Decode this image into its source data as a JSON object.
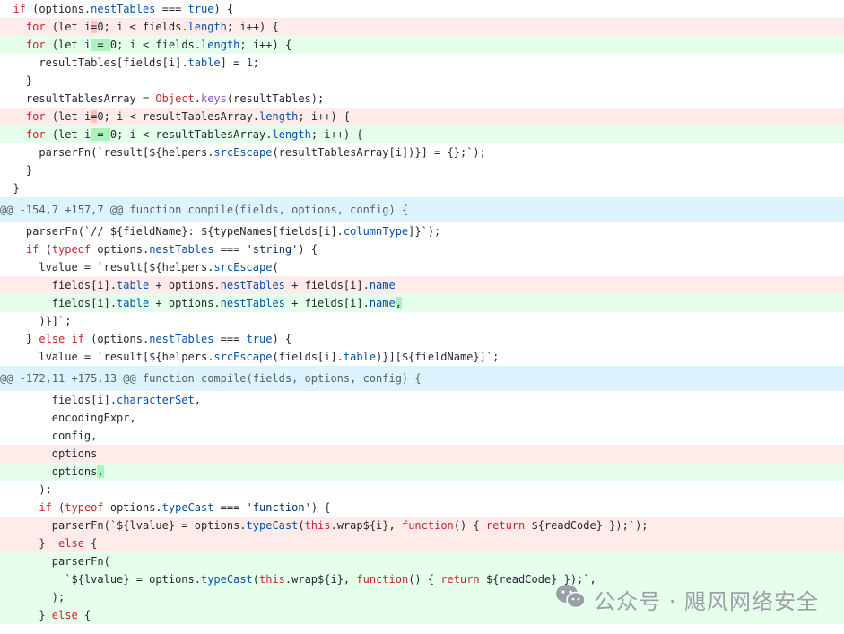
{
  "diff": {
    "lines": [
      {
        "type": "ctx",
        "tokens": [
          {
            "t": "  "
          },
          {
            "t": "if",
            "c": "kw"
          },
          {
            "t": " (options."
          },
          {
            "t": "nestTables",
            "c": "prop"
          },
          {
            "t": " === "
          },
          {
            "t": "true",
            "c": "prop"
          },
          {
            "t": ") {"
          }
        ]
      },
      {
        "type": "del",
        "tokens": [
          {
            "t": "    "
          },
          {
            "t": "for",
            "c": "kw"
          },
          {
            "t": " (let i"
          },
          {
            "t": "=",
            "c": "hl-del"
          },
          {
            "t": "0; i < fields."
          },
          {
            "t": "length",
            "c": "prop"
          },
          {
            "t": "; i++) {"
          }
        ]
      },
      {
        "type": "add",
        "tokens": [
          {
            "t": "    "
          },
          {
            "t": "for",
            "c": "kw"
          },
          {
            "t": " (let i"
          },
          {
            "t": " = ",
            "c": "hl-add"
          },
          {
            "t": "0; i < fields."
          },
          {
            "t": "length",
            "c": "prop"
          },
          {
            "t": "; i++) {"
          }
        ]
      },
      {
        "type": "ctx",
        "tokens": [
          {
            "t": "      resultTables[fields[i]."
          },
          {
            "t": "table",
            "c": "prop"
          },
          {
            "t": "] = "
          },
          {
            "t": "1",
            "c": "prop"
          },
          {
            "t": ";"
          }
        ]
      },
      {
        "type": "ctx",
        "tokens": [
          {
            "t": "    }"
          }
        ]
      },
      {
        "type": "ctx",
        "tokens": [
          {
            "t": "    resultTablesArray = "
          },
          {
            "t": "Object",
            "c": "kw"
          },
          {
            "t": "."
          },
          {
            "t": "keys",
            "c": "fn"
          },
          {
            "t": "(resultTables);"
          }
        ]
      },
      {
        "type": "del",
        "tokens": [
          {
            "t": "    "
          },
          {
            "t": "for",
            "c": "kw"
          },
          {
            "t": " (let i"
          },
          {
            "t": "=",
            "c": "hl-del"
          },
          {
            "t": "0; i < resultTablesArray."
          },
          {
            "t": "length",
            "c": "prop"
          },
          {
            "t": "; i++) {"
          }
        ]
      },
      {
        "type": "add",
        "tokens": [
          {
            "t": "    "
          },
          {
            "t": "for",
            "c": "kw"
          },
          {
            "t": " (let i"
          },
          {
            "t": " = ",
            "c": "hl-add"
          },
          {
            "t": "0; i < resultTablesArray."
          },
          {
            "t": "length",
            "c": "prop"
          },
          {
            "t": "; i++) {"
          }
        ]
      },
      {
        "type": "ctx",
        "tokens": [
          {
            "t": "      parserFn(`result[${helpers."
          },
          {
            "t": "srcEscape",
            "c": "prop"
          },
          {
            "t": "(resultTablesArray[i])}] = {};`);"
          }
        ]
      },
      {
        "type": "ctx",
        "tokens": [
          {
            "t": "    }"
          }
        ]
      },
      {
        "type": "ctx",
        "tokens": [
          {
            "t": "  }"
          }
        ]
      },
      {
        "type": "hunk",
        "tokens": [
          {
            "t": "@@ -154,7 +157,7 @@ function compile(fields, options, config) {"
          }
        ]
      },
      {
        "type": "ctx",
        "tokens": [
          {
            "t": "    parserFn(`// ${fieldName}: ${typeNames[fields[i]."
          },
          {
            "t": "columnType",
            "c": "prop"
          },
          {
            "t": "]}`);"
          }
        ]
      },
      {
        "type": "ctx",
        "tokens": [
          {
            "t": "    "
          },
          {
            "t": "if",
            "c": "kw"
          },
          {
            "t": " ("
          },
          {
            "t": "typeof",
            "c": "kw"
          },
          {
            "t": " options."
          },
          {
            "t": "nestTables",
            "c": "prop"
          },
          {
            "t": " === "
          },
          {
            "t": "'string'",
            "c": "str"
          },
          {
            "t": ") {"
          }
        ]
      },
      {
        "type": "ctx",
        "tokens": [
          {
            "t": "      lvalue = `result[${helpers."
          },
          {
            "t": "srcEscape",
            "c": "prop"
          },
          {
            "t": "("
          }
        ]
      },
      {
        "type": "del",
        "tokens": [
          {
            "t": "        fields[i]."
          },
          {
            "t": "table",
            "c": "prop"
          },
          {
            "t": " + options."
          },
          {
            "t": "nestTables",
            "c": "prop"
          },
          {
            "t": " + fields[i]."
          },
          {
            "t": "name",
            "c": "prop"
          }
        ]
      },
      {
        "type": "add",
        "tokens": [
          {
            "t": "        fields[i]."
          },
          {
            "t": "table",
            "c": "prop"
          },
          {
            "t": " + options."
          },
          {
            "t": "nestTables",
            "c": "prop"
          },
          {
            "t": " + fields[i]."
          },
          {
            "t": "name",
            "c": "prop"
          },
          {
            "t": ",",
            "c": "hl-add"
          }
        ]
      },
      {
        "type": "ctx",
        "tokens": [
          {
            "t": "      )}]`;"
          }
        ]
      },
      {
        "type": "ctx",
        "tokens": [
          {
            "t": "    } "
          },
          {
            "t": "else",
            "c": "kw"
          },
          {
            "t": " "
          },
          {
            "t": "if",
            "c": "kw"
          },
          {
            "t": " (options."
          },
          {
            "t": "nestTables",
            "c": "prop"
          },
          {
            "t": " === "
          },
          {
            "t": "true",
            "c": "prop"
          },
          {
            "t": ") {"
          }
        ]
      },
      {
        "type": "ctx",
        "tokens": [
          {
            "t": "      lvalue = `result[${helpers."
          },
          {
            "t": "srcEscape",
            "c": "prop"
          },
          {
            "t": "(fields[i]."
          },
          {
            "t": "table",
            "c": "prop"
          },
          {
            "t": ")}][${fieldName}]`;"
          }
        ]
      },
      {
        "type": "hunk",
        "tokens": [
          {
            "t": "@@ -172,11 +175,13 @@ function compile(fields, options, config) {"
          }
        ]
      },
      {
        "type": "ctx",
        "tokens": [
          {
            "t": "        fields[i]."
          },
          {
            "t": "characterSet",
            "c": "prop"
          },
          {
            "t": ","
          }
        ]
      },
      {
        "type": "ctx",
        "tokens": [
          {
            "t": "        encodingExpr,"
          }
        ]
      },
      {
        "type": "ctx",
        "tokens": [
          {
            "t": "        config,"
          }
        ]
      },
      {
        "type": "del",
        "tokens": [
          {
            "t": "        options"
          }
        ]
      },
      {
        "type": "add",
        "tokens": [
          {
            "t": "        options"
          },
          {
            "t": ",",
            "c": "hl-add"
          }
        ]
      },
      {
        "type": "ctx",
        "tokens": [
          {
            "t": "      );"
          }
        ]
      },
      {
        "type": "ctx",
        "tokens": [
          {
            "t": "      "
          },
          {
            "t": "if",
            "c": "kw"
          },
          {
            "t": " ("
          },
          {
            "t": "typeof",
            "c": "kw"
          },
          {
            "t": " options."
          },
          {
            "t": "typeCast",
            "c": "prop"
          },
          {
            "t": " === "
          },
          {
            "t": "'function'",
            "c": "str"
          },
          {
            "t": ") {"
          }
        ]
      },
      {
        "type": "del",
        "tokens": [
          {
            "t": "        parserFn(`${lvalue} = options."
          },
          {
            "t": "typeCast",
            "c": "prop"
          },
          {
            "t": "("
          },
          {
            "t": "this",
            "c": "kw"
          },
          {
            "t": ".wrap${i}, "
          },
          {
            "t": "function",
            "c": "kw"
          },
          {
            "t": "() { "
          },
          {
            "t": "return",
            "c": "kw"
          },
          {
            "t": " ${readCode} });`);"
          }
        ]
      },
      {
        "type": "del",
        "tokens": [
          {
            "t": "      }  "
          },
          {
            "t": "else",
            "c": "kw"
          },
          {
            "t": " {"
          }
        ]
      },
      {
        "type": "add",
        "tokens": [
          {
            "t": "        parserFn("
          }
        ]
      },
      {
        "type": "add",
        "tokens": [
          {
            "t": "          `${lvalue} = options."
          },
          {
            "t": "typeCast",
            "c": "prop"
          },
          {
            "t": "("
          },
          {
            "t": "this",
            "c": "kw"
          },
          {
            "t": ".wrap${i}, "
          },
          {
            "t": "function",
            "c": "kw"
          },
          {
            "t": "() { "
          },
          {
            "t": "return",
            "c": "kw"
          },
          {
            "t": " ${readCode} });`,"
          }
        ]
      },
      {
        "type": "add",
        "tokens": [
          {
            "t": "        );"
          }
        ]
      },
      {
        "type": "add",
        "tokens": [
          {
            "t": "      } "
          },
          {
            "t": "else",
            "c": "kw"
          },
          {
            "t": " {"
          }
        ]
      }
    ]
  },
  "watermark": {
    "text": "公众号 · 飓风网络安全",
    "icon": "wechat-icon",
    "color": "#9aa0a6"
  }
}
